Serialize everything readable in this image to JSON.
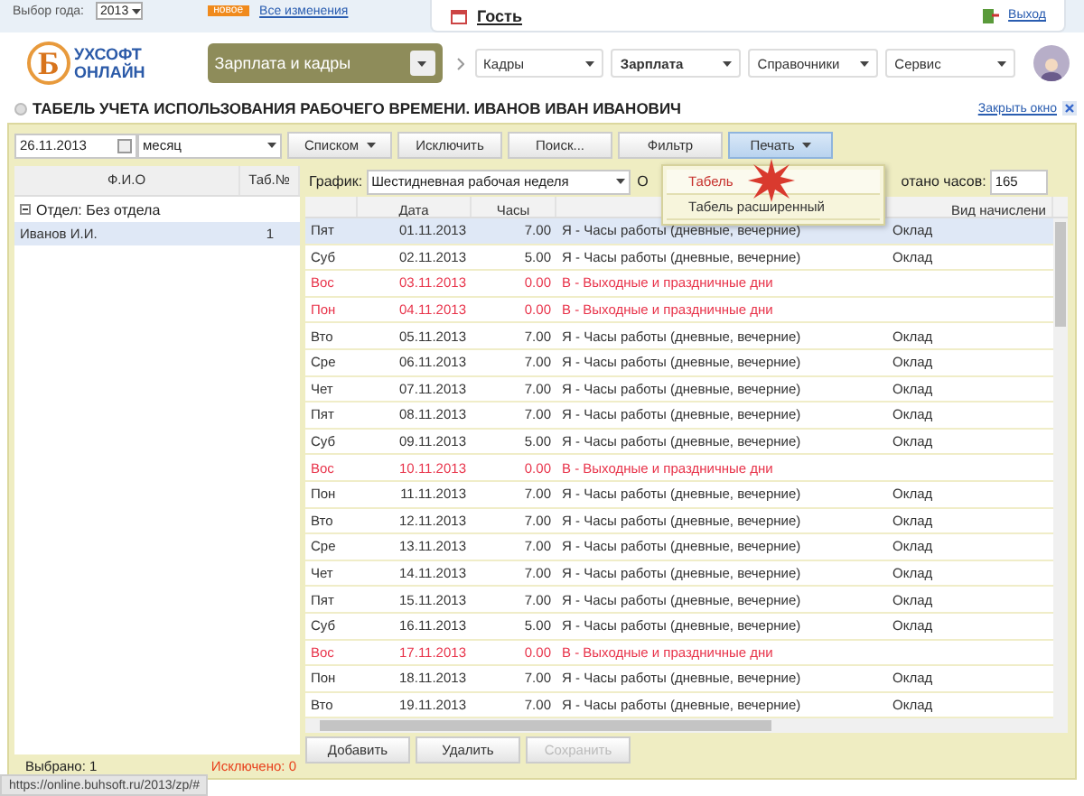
{
  "top_bar": {
    "year_label": "Выбор года:",
    "year": "2013",
    "badge": "новое",
    "changes_link": "Все изменения",
    "user": "Гость",
    "logout": "Выход"
  },
  "logo": {
    "mark": "Б",
    "line1": "УХСОФТ",
    "line2": "ОНЛАЙН"
  },
  "product_menu": "Зарплата и кадры",
  "nav": [
    {
      "label": "Кадры",
      "selected": false
    },
    {
      "label": "Зарплата",
      "selected": true
    },
    {
      "label": "Справочники",
      "selected": false
    },
    {
      "label": "Сервис",
      "selected": false
    }
  ],
  "title": "ТАБЕЛЬ УЧЕТА ИСПОЛЬЗОВАНИЯ РАБОЧЕГО ВРЕМЕНИ. ИВАНОВ ИВАН ИВАНОВИЧ",
  "close_link": "Закрыть окно",
  "toolbar": {
    "date": "26.11.2013",
    "period": "месяц",
    "buttons": [
      {
        "label": "Списком",
        "dropdown": true,
        "selected": false
      },
      {
        "label": "Исключить",
        "dropdown": false,
        "selected": false
      },
      {
        "label": "Поиск...",
        "dropdown": false,
        "selected": false
      },
      {
        "label": "Фильтр",
        "dropdown": false,
        "selected": false
      },
      {
        "label": "Печать",
        "dropdown": true,
        "selected": true
      }
    ]
  },
  "print_menu": [
    {
      "label": "Табель",
      "selected": true
    },
    {
      "label": "Табель расширенный",
      "selected": false
    }
  ],
  "employees": {
    "columns": [
      "Ф.И.О",
      "Таб.№"
    ],
    "group": "Отдел: Без отдела",
    "rows": [
      {
        "name": "Иванов И.И.",
        "number": "1",
        "selected": true
      }
    ],
    "selected_count": "Выбрано: 1",
    "excluded_count": "Исключено: 0"
  },
  "schedule": {
    "label": "График:",
    "value": "Шестидневная рабочая неделя",
    "partial_label": "О",
    "hours_label": "отано часов:",
    "hours": "165"
  },
  "timesheet": {
    "columns": [
      "Дата",
      "Часы",
      "Вид начислени"
    ],
    "rows": [
      {
        "day": "Пят",
        "date": "01.11.2013",
        "hours": "7.00",
        "type": "Я - Часы работы (дневные, вечерние)",
        "accrual": "Оклад",
        "holiday": false,
        "selected": true
      },
      {
        "day": "Суб",
        "date": "02.11.2013",
        "hours": "5.00",
        "type": "Я - Часы работы (дневные, вечерние)",
        "accrual": "Оклад",
        "holiday": false,
        "selected": false
      },
      {
        "day": "Вос",
        "date": "03.11.2013",
        "hours": "0.00",
        "type": "В - Выходные и праздничные дни",
        "holiday": true,
        "selected": false
      },
      {
        "day": "Пон",
        "date": "04.11.2013",
        "hours": "0.00",
        "type": "В - Выходные и праздничные дни",
        "holiday": true,
        "selected": false
      },
      {
        "day": "Вто",
        "date": "05.11.2013",
        "hours": "7.00",
        "type": "Я - Часы работы (дневные, вечерние)",
        "accrual": "Оклад",
        "holiday": false,
        "selected": false
      },
      {
        "day": "Сре",
        "date": "06.11.2013",
        "hours": "7.00",
        "type": "Я - Часы работы (дневные, вечерние)",
        "accrual": "Оклад",
        "holiday": false,
        "selected": false
      },
      {
        "day": "Чет",
        "date": "07.11.2013",
        "hours": "7.00",
        "type": "Я - Часы работы (дневные, вечерние)",
        "accrual": "Оклад",
        "holiday": false,
        "selected": false
      },
      {
        "day": "Пят",
        "date": "08.11.2013",
        "hours": "7.00",
        "type": "Я - Часы работы (дневные, вечерние)",
        "accrual": "Оклад",
        "holiday": false,
        "selected": false
      },
      {
        "day": "Суб",
        "date": "09.11.2013",
        "hours": "5.00",
        "type": "Я - Часы работы (дневные, вечерние)",
        "accrual": "Оклад",
        "holiday": false,
        "selected": false
      },
      {
        "day": "Вос",
        "date": "10.11.2013",
        "hours": "0.00",
        "type": "В - Выходные и праздничные дни",
        "holiday": true,
        "selected": false
      },
      {
        "day": "Пон",
        "date": "11.11.2013",
        "hours": "7.00",
        "type": "Я - Часы работы (дневные, вечерние)",
        "accrual": "Оклад",
        "holiday": false,
        "selected": false
      },
      {
        "day": "Вто",
        "date": "12.11.2013",
        "hours": "7.00",
        "type": "Я - Часы работы (дневные, вечерние)",
        "accrual": "Оклад",
        "holiday": false,
        "selected": false
      },
      {
        "day": "Сре",
        "date": "13.11.2013",
        "hours": "7.00",
        "type": "Я - Часы работы (дневные, вечерние)",
        "accrual": "Оклад",
        "holiday": false,
        "selected": false
      },
      {
        "day": "Чет",
        "date": "14.11.2013",
        "hours": "7.00",
        "type": "Я - Часы работы (дневные, вечерние)",
        "accrual": "Оклад",
        "holiday": false,
        "selected": false
      },
      {
        "day": "Пят",
        "date": "15.11.2013",
        "hours": "7.00",
        "type": "Я - Часы работы (дневные, вечерние)",
        "accrual": "Оклад",
        "holiday": false,
        "selected": false
      },
      {
        "day": "Суб",
        "date": "16.11.2013",
        "hours": "5.00",
        "type": "Я - Часы работы (дневные, вечерние)",
        "accrual": "Оклад",
        "holiday": false,
        "selected": false
      },
      {
        "day": "Вос",
        "date": "17.11.2013",
        "hours": "0.00",
        "type": "В - Выходные и праздничные дни",
        "holiday": true,
        "selected": false
      },
      {
        "day": "Пон",
        "date": "18.11.2013",
        "hours": "7.00",
        "type": "Я - Часы работы (дневные, вечерние)",
        "accrual": "Оклад",
        "holiday": false,
        "selected": false
      },
      {
        "day": "Вто",
        "date": "19.11.2013",
        "hours": "7.00",
        "type": "Я - Часы работы (дневные, вечерние)",
        "accrual": "Оклад",
        "holiday": false,
        "selected": false
      }
    ]
  },
  "buttons": [
    {
      "label": "Добавить",
      "disabled": false
    },
    {
      "label": "Удалить",
      "disabled": false
    },
    {
      "label": "Сохранить",
      "disabled": true
    }
  ],
  "status_url": "https://online.buhsoft.ru/2013/zp/#"
}
